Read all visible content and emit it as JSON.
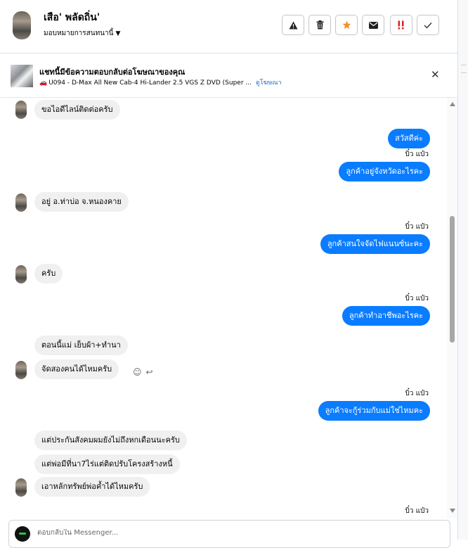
{
  "header": {
    "name": "เสือ' พลัดถิ่น'",
    "assign_label": "มอบหมายการสนทนานี้",
    "buttons": [
      {
        "icon": "alert-triangle-icon"
      },
      {
        "icon": "trash-icon"
      },
      {
        "icon": "star-icon",
        "color": "#f0932b"
      },
      {
        "icon": "envelope-icon"
      },
      {
        "icon": "exclamation-icon",
        "color": "#e02020"
      },
      {
        "icon": "check-icon"
      }
    ]
  },
  "ad": {
    "title": "แชทนี้มีข้อความตอบกลับต่อโฆษณาของคุณ",
    "description": "U094 - D-Max All New Cab-4 Hi-Lander 2.5 VGS Z DVD (Super ...",
    "link": "ดูโฆษณา"
  },
  "messages": [
    {
      "side": "in",
      "text": "ขอไอดีไลน์ติดต่อครับ"
    },
    {
      "side": "out",
      "text": "สวัสดีค่ะ"
    },
    {
      "side": "seen",
      "text": "บิ๋ว แป๋ว"
    },
    {
      "side": "out",
      "text": "ลูกค้าอยู่จังหวัดอะไรคะ"
    },
    {
      "side": "in",
      "text": "อยู่ อ.ท่าบ่อ จ.หนองคาย"
    },
    {
      "side": "seen",
      "text": "บิ๋ว แป๋ว"
    },
    {
      "side": "out",
      "text": "ลูกค้าสนใจจัดไฟแนนซ์นะคะ"
    },
    {
      "side": "in",
      "text": "ครับ"
    },
    {
      "side": "seen",
      "text": "บิ๋ว แป๋ว"
    },
    {
      "side": "out",
      "text": "ลูกค้าทำอาชีพอะไรคะ"
    },
    {
      "side": "in",
      "text": "ตอนนี้แม่ เย็บผ้า+ทำนา"
    },
    {
      "side": "in",
      "text": "จัดสองคนได้ไหมครับ"
    },
    {
      "side": "seen",
      "text": "บิ๋ว แป๋ว"
    },
    {
      "side": "out",
      "text": "ลูกค้าจะกู้ร่วมกับแม่ใช่ไหมคะ"
    },
    {
      "side": "in",
      "text": "แต่ประกันสังคมผมยังไม่ถึงหกเดือนนะครับ"
    },
    {
      "side": "in",
      "text": "แต่พ่อมีที่นา7ไร่แต่ติดปรับโครงสร้างหนี้"
    },
    {
      "side": "in",
      "text": "เอาหลักทรัพย์พ่อค้ำได้ไหมครับ"
    },
    {
      "side": "seen",
      "text": "บิ๋ว แป๋ว"
    }
  ],
  "composer": {
    "placeholder": "ตอบกลับใน Messenger..."
  }
}
